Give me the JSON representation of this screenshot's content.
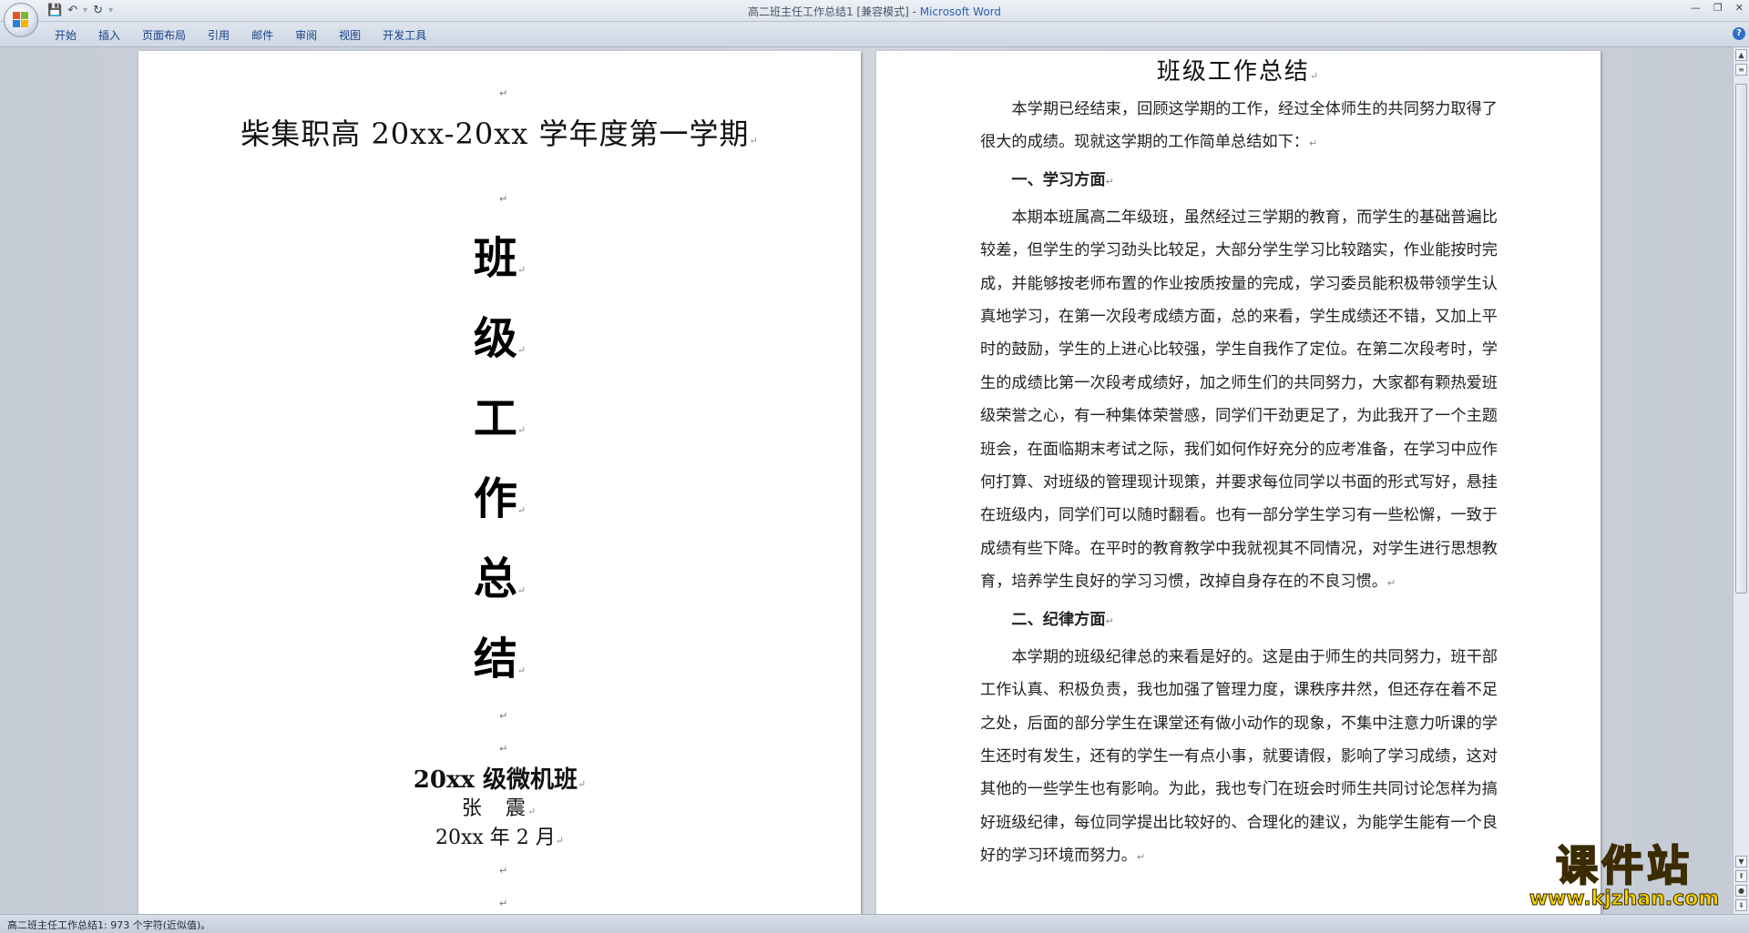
{
  "window": {
    "title_doc": "高二班主任工作总结1 [兼容模式] - ",
    "title_app": "Microsoft Word",
    "minimize": "—",
    "restore": "❐",
    "close": "✕"
  },
  "quick_access": {
    "save_icon": "💾",
    "undo_icon": "↶",
    "redo_icon": "↻",
    "customize_icon": "▾"
  },
  "ribbon": {
    "tabs": [
      "开始",
      "插入",
      "页面布局",
      "引用",
      "邮件",
      "审阅",
      "视图",
      "开发工具"
    ],
    "help": "?"
  },
  "cover_page": {
    "school_title": "柴集职高 20xx-20xx 学年度第一学期",
    "big_chars": [
      "班",
      "级",
      "工",
      "作",
      "总",
      "结"
    ],
    "class_name": "20xx 级微机班",
    "author": "张　震",
    "date": "20xx 年 2 月",
    "para_mark": "↵"
  },
  "content_page": {
    "title": "班级工作总结",
    "intro": "本学期已经结束，回顾这学期的工作，经过全体师生的共同努力取得了很大的成绩。现就这学期的工作简单总结如下：",
    "heading1": "一、学习方面",
    "para1": "本期本班属高二年级班，虽然经过三学期的教育，而学生的基础普遍比较差，但学生的学习劲头比较足，大部分学生学习比较踏实，作业能按时完成，并能够按老师布置的作业按质按量的完成，学习委员能积极带领学生认真地学习，在第一次段考成绩方面，总的来看，学生成绩还不错，又加上平时的鼓励，学生的上进心比较强，学生自我作了定位。在第二次段考时，学生的成绩比第一次段考成绩好，加之师生们的共同努力，大家都有颗热爱班级荣誉之心，有一种集体荣誉感，同学们干劲更足了，为此我开了一个主题班会，在面临期末考试之际，我们如何作好充分的应考准备，在学习中应作何打算、对班级的管理现计现策，并要求每位同学以书面的形式写好，悬挂在班级内，同学们可以随时翻看。也有一部分学生学习有一些松懈，一致于成绩有些下降。在平时的教育教学中我就视其不同情况，对学生进行思想教育，培养学生良好的学习习惯，改掉自身存在的不良习惯。",
    "heading2": "二、纪律方面",
    "para2": "本学期的班级纪律总的来看是好的。这是由于师生的共同努力，班干部工作认真、积极负责，我也加强了管理力度，课秩序井然，但还存在着不足之处，后面的部分学生在课堂还有做小动作的现象，不集中注意力听课的学生还时有发生，还有的学生一有点小事，就要请假，影响了学习成绩，这对其他的一些学生也有影响。为此，我也专门在班会时师生共同讨论怎样为搞好班级纪律，每位同学提出比较好的、合理化的建议，为能学生能有一个良好的学习环境而努力。"
  },
  "status_bar": {
    "text": "高二班主任工作总结1: 973 个字符(近似值)。"
  },
  "watermark": {
    "line1": "课件站",
    "line2": "www.kjzhan.com"
  },
  "colors": {
    "accent": "#2b5fb3",
    "tab_text": "#15428b",
    "watermark": "#f5d400"
  }
}
